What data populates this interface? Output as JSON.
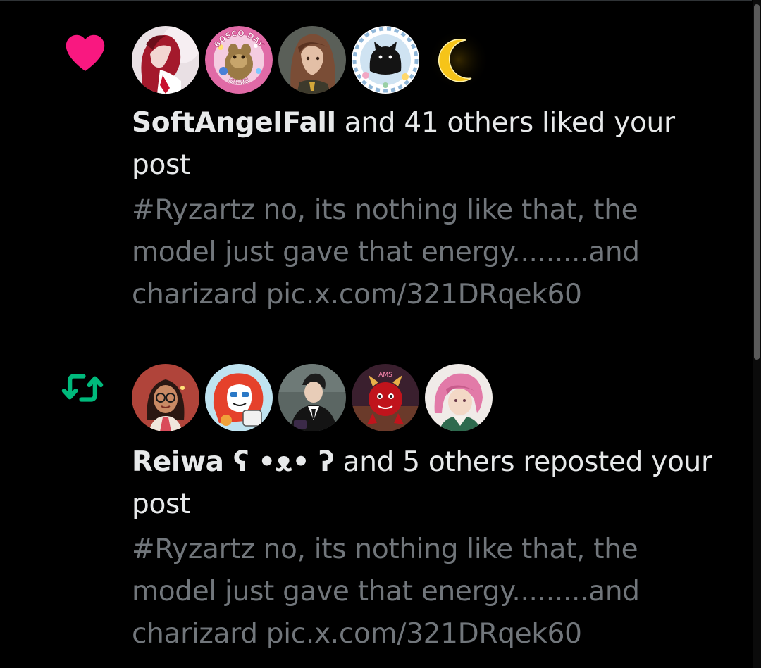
{
  "colors": {
    "background": "#000000",
    "primary_text": "#e7e9ea",
    "secondary_text": "#71767b",
    "like_accent": "#f91880",
    "repost_accent": "#00ba7c",
    "divider": "#2f3336"
  },
  "notifications": [
    {
      "type": "like",
      "icon": "heart-icon",
      "avatars": [
        {
          "icon": "avatar-red-hair-character"
        },
        {
          "icon": "avatar-bosco-day-badge",
          "text_top": "BOSCO DAY",
          "text_bottom": "07-08"
        },
        {
          "icon": "avatar-brown-hair-character"
        },
        {
          "icon": "avatar-black-cat"
        },
        {
          "icon": "avatar-crescent-moon"
        }
      ],
      "actor": "SoftAngelFall",
      "summary_rest": " and 41 others liked your post",
      "snippet_lines": [
        "#Ryzartz no, its nothing like that, the",
        "model just gave that energy.........and",
        "charizard pic.x.com/321DRqek60"
      ]
    },
    {
      "type": "repost",
      "icon": "repost-icon",
      "avatars": [
        {
          "icon": "avatar-glasses-person"
        },
        {
          "icon": "avatar-red-furry-character"
        },
        {
          "icon": "avatar-suit-character"
        },
        {
          "icon": "avatar-red-horned-creature",
          "text_top": "AMS"
        },
        {
          "icon": "avatar-pink-hair-character"
        }
      ],
      "actor": "Reiwa ʕ •ᴥ• ʔ",
      "summary_rest": " and 5 others reposted your post",
      "snippet_lines": [
        "#Ryzartz no, its nothing like that, the",
        "model just gave that energy.........and",
        "charizard pic.x.com/321DRqek60"
      ]
    }
  ]
}
